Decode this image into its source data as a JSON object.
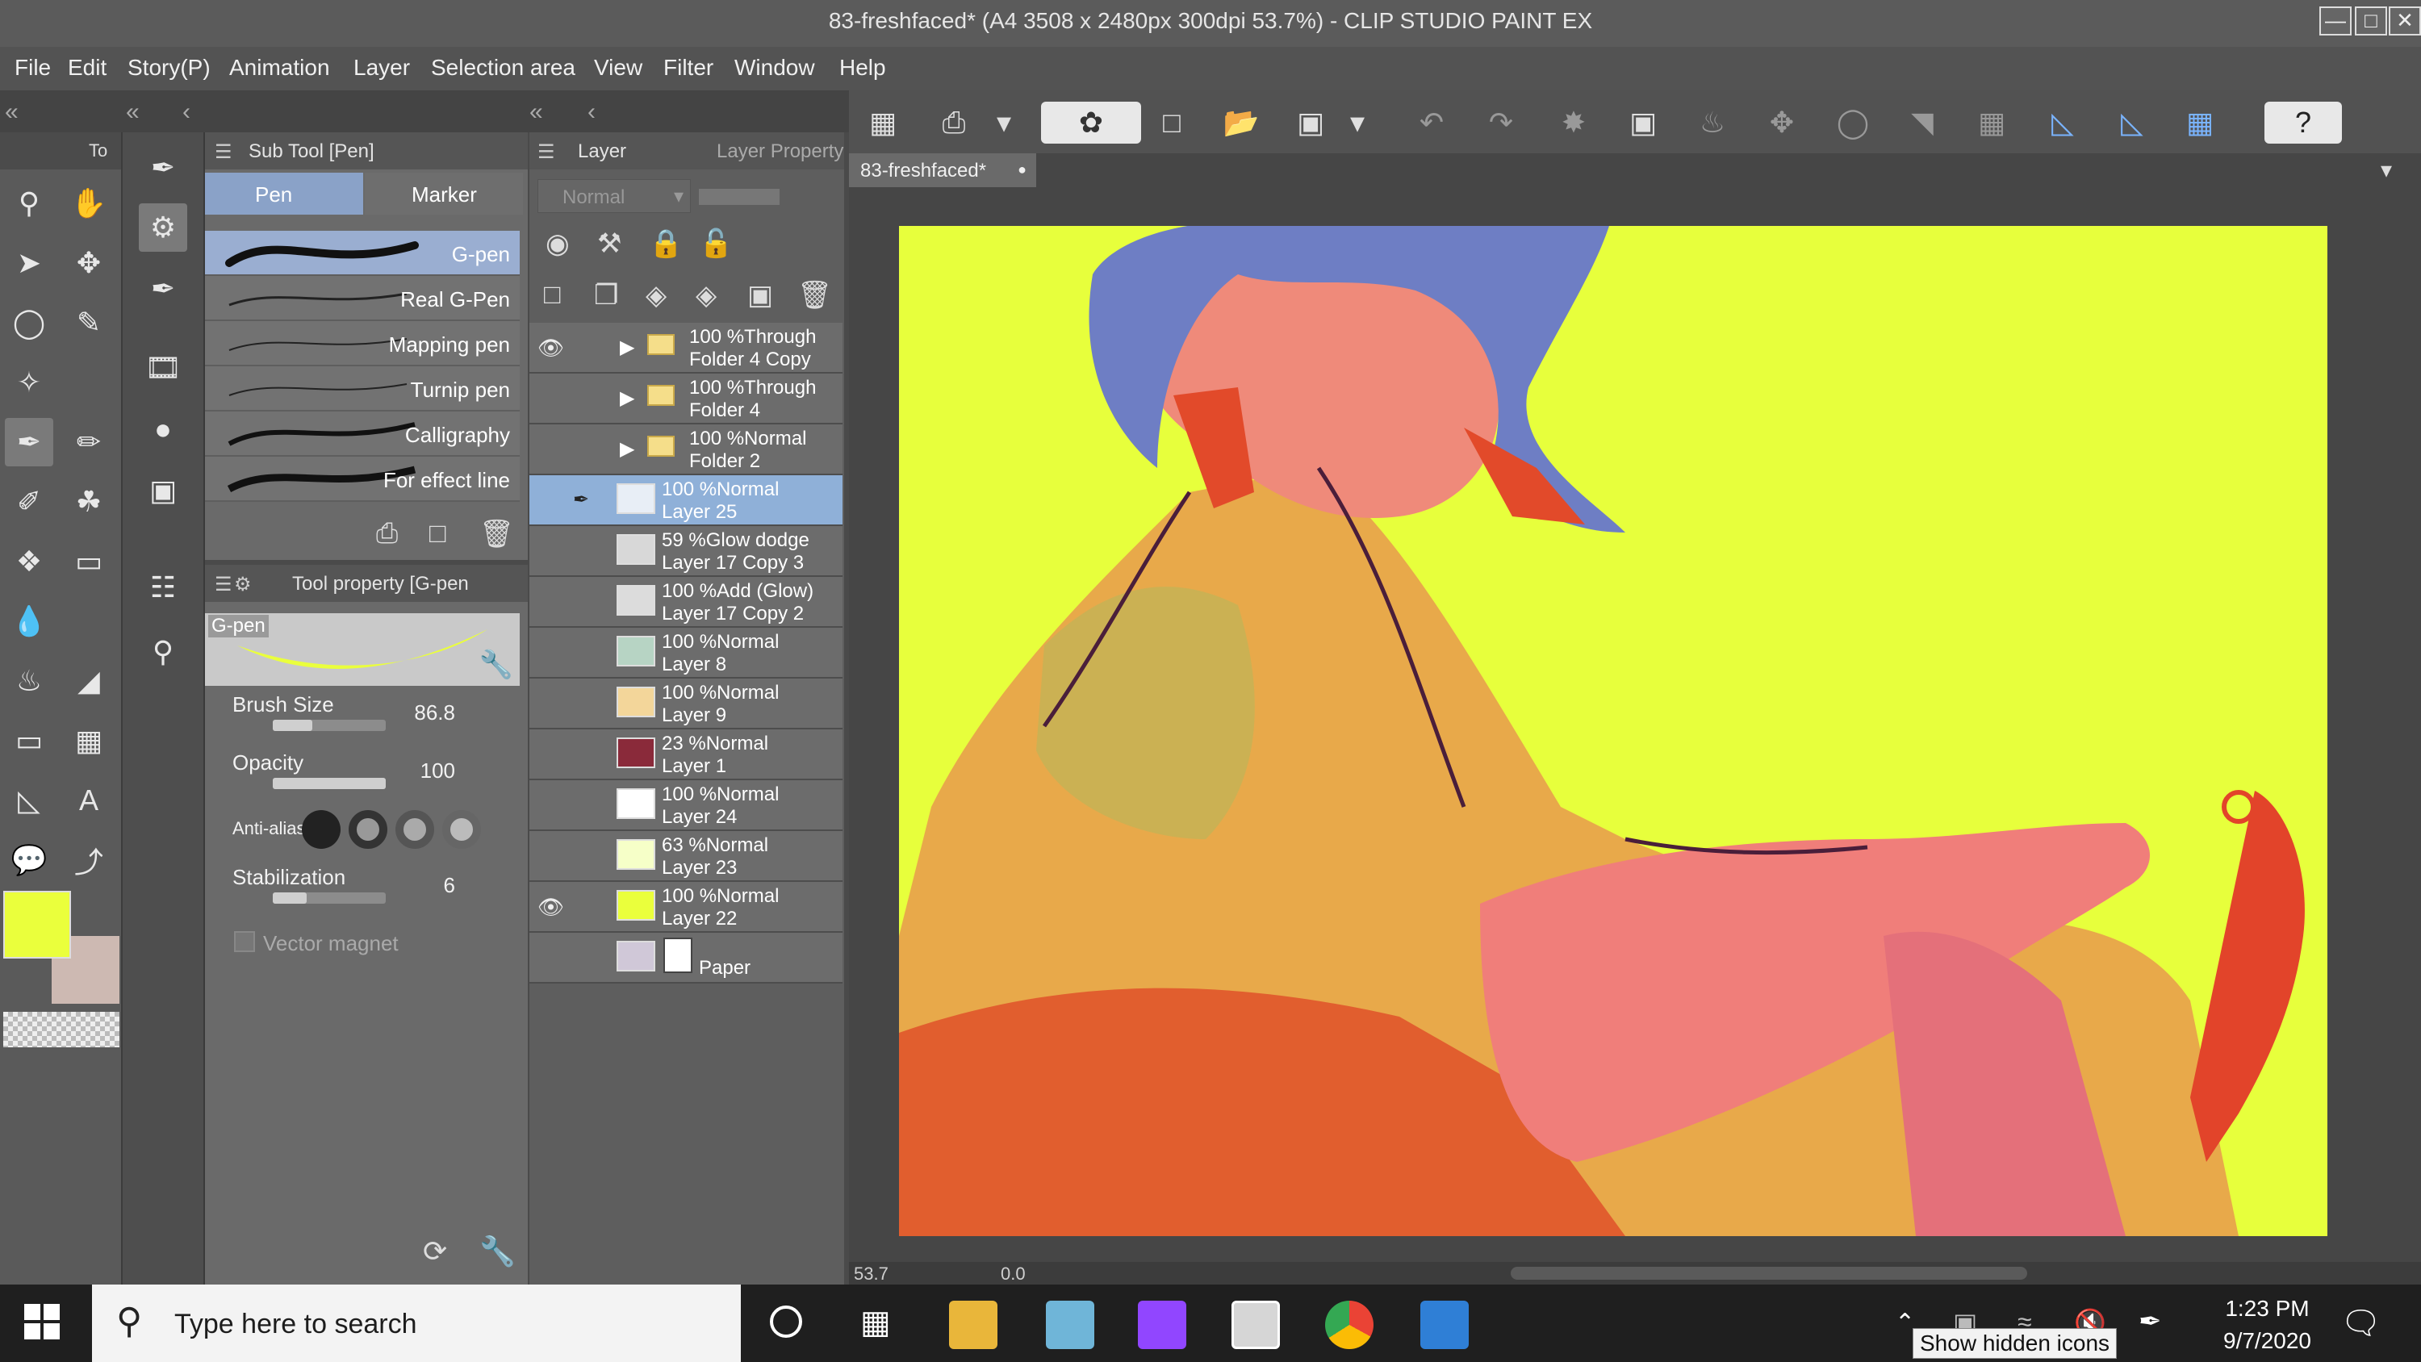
{
  "window": {
    "title": "83-freshfaced* (A4 3508 x 2480px 300dpi 53.7%)  - CLIP STUDIO PAINT EX",
    "min_glyph": "—",
    "max_glyph": "□",
    "close_glyph": "✕"
  },
  "menu": [
    "File",
    "Edit",
    "Story(P)",
    "Animation",
    "Layer",
    "Selection area",
    "View",
    "Filter",
    "Window",
    "Help"
  ],
  "toolbox": {
    "header": "To"
  },
  "subtool": {
    "title": "Sub Tool [Pen]",
    "tabs": [
      "Pen",
      "Marker"
    ],
    "brushes": [
      "G-pen",
      "Real G-Pen",
      "Mapping pen",
      "Turnip pen",
      "Calligraphy",
      "For effect line"
    ]
  },
  "toolprop": {
    "title": "Tool property [G-pen",
    "preview_label": "G-pen",
    "brush_size_label": "Brush Size",
    "brush_size": "86.8",
    "brush_size_fraction": 0.35,
    "opacity_label": "Opacity",
    "opacity": "100",
    "opacity_fraction": 1.0,
    "antialias_label": "Anti-alias",
    "stabilization_label": "Stabilization",
    "stabilization": "6",
    "stabilization_fraction": 0.3,
    "vector_magnet_label": "Vector magnet"
  },
  "colors": {
    "main": "#eaff3c",
    "sub": "#cdb9b2",
    "canvas_bg": "#e7ff3c",
    "selection_blue": "#8fb0d8"
  },
  "layerpanel": {
    "tab_layer": "Layer",
    "tab_property": "Layer Property",
    "blend_mode": "Normal",
    "layers": [
      {
        "line1": "100 %Through",
        "line2": "Folder 4 Copy",
        "type": "folder",
        "eye": true,
        "selected": false,
        "thumb": ""
      },
      {
        "line1": "100 %Through",
        "line2": "Folder 4",
        "type": "folder",
        "eye": false,
        "selected": false,
        "thumb": ""
      },
      {
        "line1": "100 %Normal",
        "line2": "Folder 2",
        "type": "folder",
        "eye": false,
        "selected": false,
        "thumb": ""
      },
      {
        "line1": "100 %Normal",
        "line2": "Layer 25",
        "type": "layer",
        "eye": false,
        "selected": true,
        "thumb": "#e8eef6"
      },
      {
        "line1": "59 %Glow dodge",
        "line2": "Layer 17 Copy 3",
        "type": "layer",
        "eye": false,
        "selected": false,
        "thumb": "#d8d8d8"
      },
      {
        "line1": "100 %Add (Glow)",
        "line2": "Layer 17 Copy 2",
        "type": "layer",
        "eye": false,
        "selected": false,
        "thumb": "#dcdcdc"
      },
      {
        "line1": "100 %Normal",
        "line2": "Layer 8",
        "type": "layer",
        "eye": false,
        "selected": false,
        "thumb": "#b7d4c4"
      },
      {
        "line1": "100 %Normal",
        "line2": "Layer 9",
        "type": "layer",
        "eye": false,
        "selected": false,
        "thumb": "#f3d69a"
      },
      {
        "line1": "23 %Normal",
        "line2": "Layer 1",
        "type": "layer",
        "eye": false,
        "selected": false,
        "thumb": "#8a2a3a"
      },
      {
        "line1": "100 %Normal",
        "line2": "Layer 24",
        "type": "layer",
        "eye": false,
        "selected": false,
        "thumb": "#ffffff"
      },
      {
        "line1": "63 %Normal",
        "line2": "Layer 23",
        "type": "layer",
        "eye": false,
        "selected": false,
        "thumb": "#f6ffc8"
      },
      {
        "line1": "100 %Normal",
        "line2": "Layer 22",
        "type": "layer",
        "eye": true,
        "selected": false,
        "thumb": "#eaff3c"
      },
      {
        "line1": "",
        "line2": "Paper",
        "type": "paper",
        "eye": false,
        "selected": false,
        "thumb": "#d0c8d8"
      }
    ]
  },
  "canvas": {
    "tab": "83-freshfaced*",
    "zoom": "53.7",
    "angle": "0.0"
  },
  "taskbar": {
    "search_placeholder": "Type here to search",
    "time": "1:23 PM",
    "date": "9/7/2020",
    "tooltip": "Show hidden icons"
  }
}
